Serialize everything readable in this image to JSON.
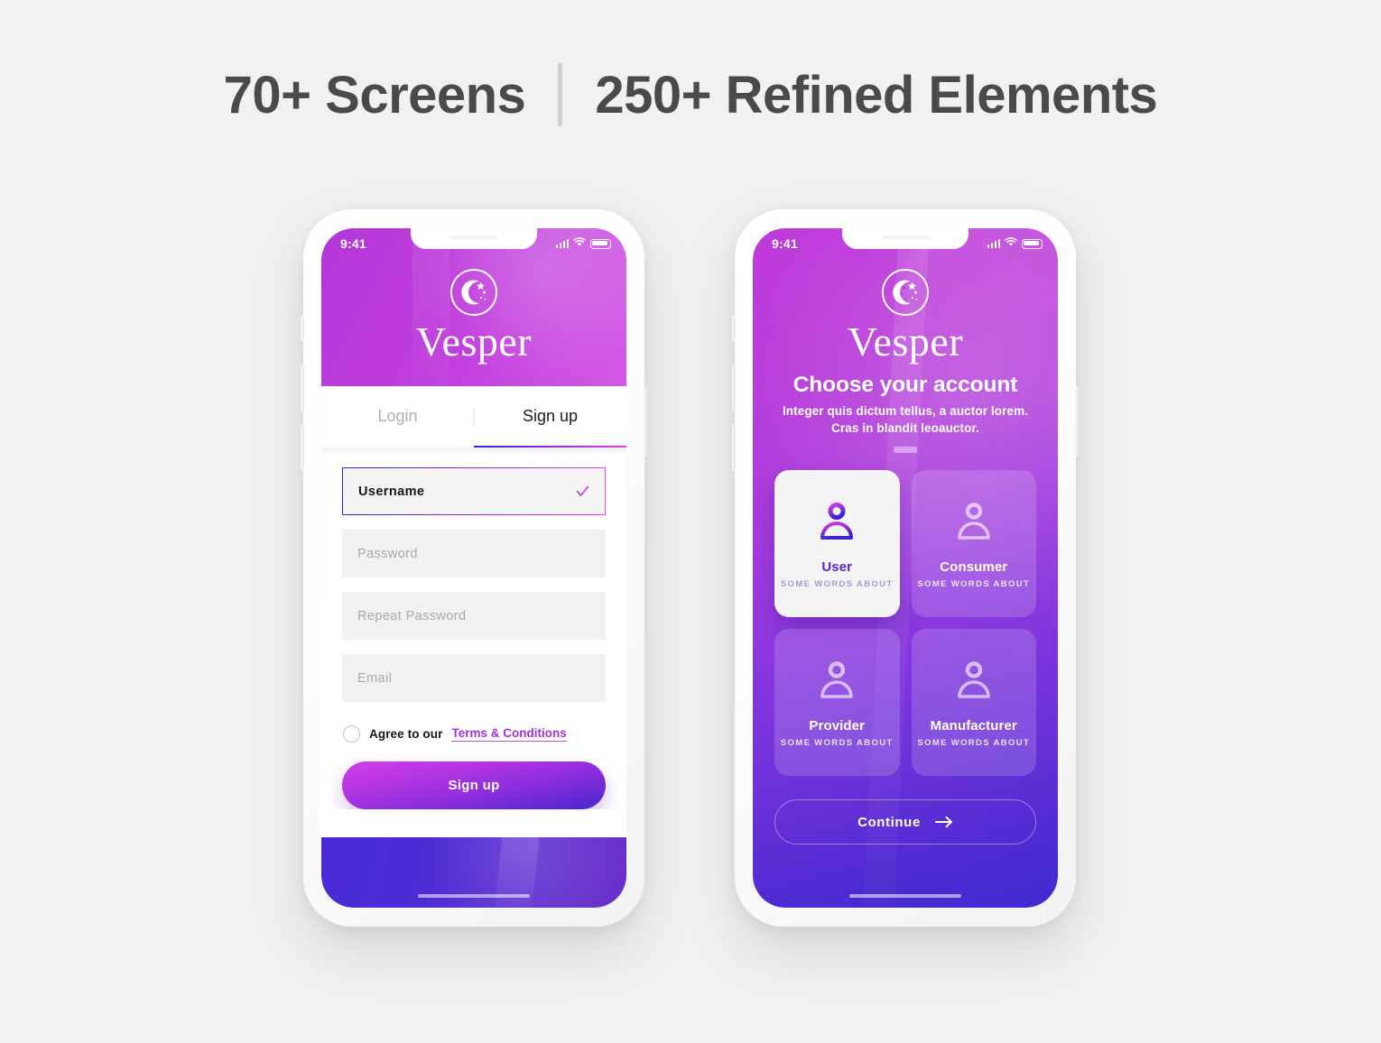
{
  "headline": {
    "left": "70+ Screens",
    "right": "250+ Refined Elements"
  },
  "colors": {
    "page_bg": "#f1f1f1",
    "accent_magenta": "#c13fdd",
    "accent_purple": "#8a2ddc",
    "accent_blue": "#3a21d6",
    "field_bg": "#f1f1f1",
    "link": "#a233d6"
  },
  "phone1": {
    "status": {
      "time": "9:41",
      "signal": "signal-icon",
      "wifi": "wifi-icon",
      "battery": "battery-icon"
    },
    "brand": {
      "logo": "moon-stars-logo-icon",
      "name": "Vesper"
    },
    "tabs": [
      {
        "label": "Login",
        "active": false
      },
      {
        "label": "Sign up",
        "active": true
      }
    ],
    "form": {
      "fields": [
        {
          "name": "username",
          "placeholder": "Username",
          "value": "Username",
          "active": true,
          "valid": true
        },
        {
          "name": "password",
          "placeholder": "Password",
          "value": "",
          "active": false,
          "valid": false
        },
        {
          "name": "repeat-password",
          "placeholder": "Repeat Password",
          "value": "",
          "active": false,
          "valid": false
        },
        {
          "name": "email",
          "placeholder": "Email",
          "value": "",
          "active": false,
          "valid": false
        }
      ],
      "terms_prefix": "Agree to our",
      "terms_link": "Terms & Conditions",
      "terms_checked": false,
      "submit_label": "Sign up"
    }
  },
  "phone2": {
    "status": {
      "time": "9:41",
      "signal": "signal-icon",
      "wifi": "wifi-icon",
      "battery": "battery-icon"
    },
    "brand": {
      "logo": "moon-stars-logo-icon",
      "name": "Vesper"
    },
    "title": "Choose your account",
    "subtitle_line1": "Integer quis dictum tellus, a auctor lorem.",
    "subtitle_line2": "Cras in blandit leoauctor.",
    "cards": [
      {
        "title": "User",
        "subtitle": "SOME WORDS ABOUT",
        "icon": "person-icon",
        "selected": true
      },
      {
        "title": "Consumer",
        "subtitle": "SOME WORDS ABOUT",
        "icon": "person-icon",
        "selected": false
      },
      {
        "title": "Provider",
        "subtitle": "SOME WORDS ABOUT",
        "icon": "person-icon",
        "selected": false
      },
      {
        "title": "Manufacturer",
        "subtitle": "SOME WORDS ABOUT",
        "icon": "person-icon",
        "selected": false
      }
    ],
    "continue_label": "Continue",
    "continue_icon": "arrow-right-icon"
  }
}
